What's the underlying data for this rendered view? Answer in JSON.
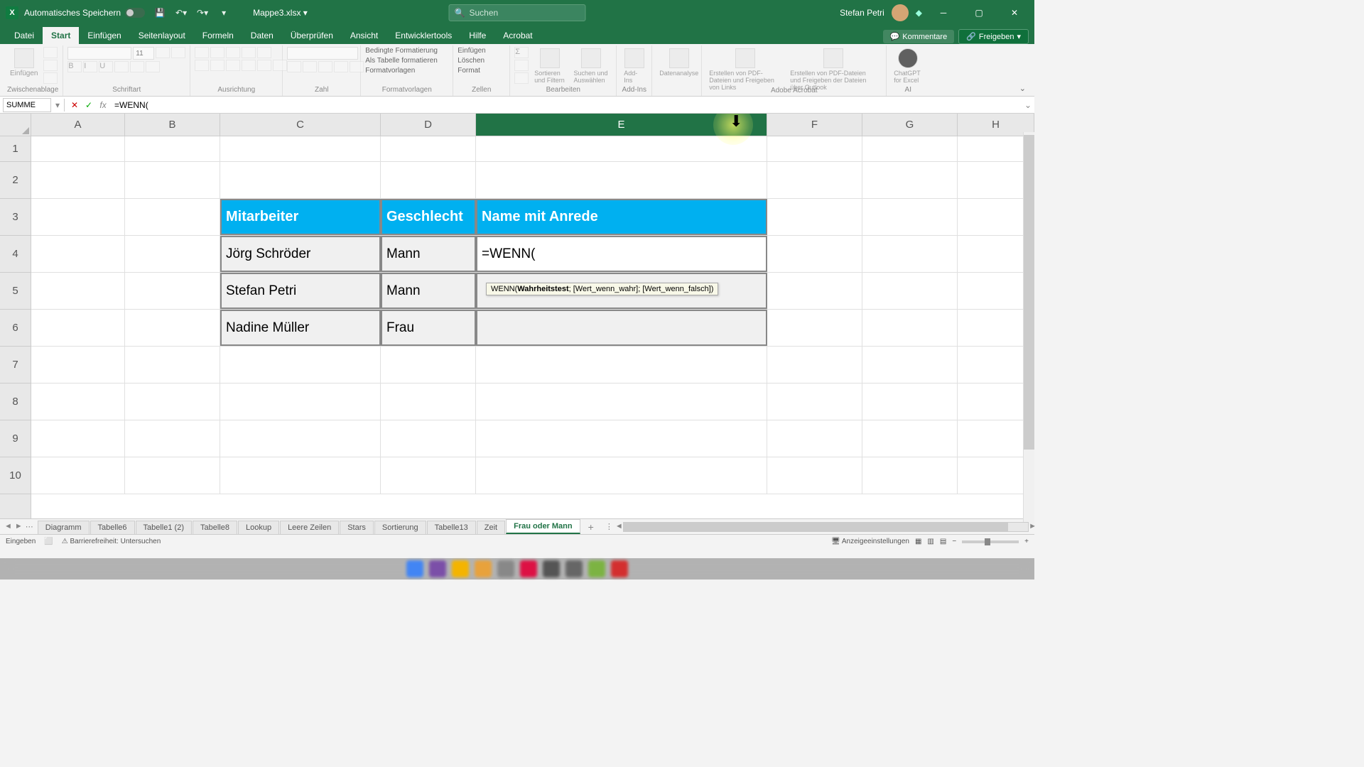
{
  "titlebar": {
    "autosave_label": "Automatisches Speichern",
    "filename": "Mappe3.xlsx",
    "search_placeholder": "Suchen",
    "username": "Stefan Petri"
  },
  "ribbon_tabs": {
    "file": "Datei",
    "home": "Start",
    "insert": "Einfügen",
    "pagelayout": "Seitenlayout",
    "formulas": "Formeln",
    "data": "Daten",
    "review": "Überprüfen",
    "view": "Ansicht",
    "developer": "Entwicklertools",
    "help": "Hilfe",
    "acrobat": "Acrobat",
    "comments": "Kommentare",
    "share": "Freigeben"
  },
  "ribbon": {
    "paste": "Einfügen",
    "clipboard": "Zwischenablage",
    "font_group": "Schriftart",
    "alignment": "Ausrichtung",
    "number": "Zahl",
    "cond_format": "Bedingte Formatierung",
    "as_table": "Als Tabelle formatieren",
    "cell_styles": "Formatvorlagen",
    "styles_group": "Formatvorlagen",
    "insert_cells": "Einfügen",
    "delete_cells": "Löschen",
    "format_cells": "Format",
    "cells_group": "Zellen",
    "sort_filter": "Sortieren und Filtern",
    "find_select": "Suchen und Auswählen",
    "editing": "Bearbeiten",
    "addins": "Add-Ins",
    "addins_group": "Add-Ins",
    "data_analysis": "Datenanalyse",
    "pdf1": "Erstellen von PDF-Dateien und Freigeben von Links",
    "pdf2": "Erstellen von PDF-Dateien und Freigeben der Dateien über Outlook",
    "acrobat_group": "Adobe Acrobat",
    "chatgpt": "ChatGPT for Excel",
    "ai_group": "AI"
  },
  "formula_bar": {
    "namebox": "SUMME",
    "formula": "=WENN("
  },
  "columns": [
    "A",
    "B",
    "C",
    "D",
    "E",
    "F",
    "G",
    "H"
  ],
  "rows": [
    "1",
    "2",
    "3",
    "4",
    "5",
    "6",
    "7",
    "8",
    "9",
    "10"
  ],
  "table": {
    "h1": "Mitarbeiter",
    "h2": "Geschlecht",
    "h3": "Name mit Anrede",
    "r1c1": "Jörg Schröder",
    "r1c2": "Mann",
    "r1c3": "=WENN(",
    "r2c1": "Stefan Petri",
    "r2c2": "Mann",
    "r3c1": "Nadine Müller",
    "r3c2": "Frau"
  },
  "tooltip": {
    "func": "WENN(",
    "bold": "Wahrheitstest",
    "rest": "; [Wert_wenn_wahr]; [Wert_wenn_falsch])"
  },
  "sheets": {
    "s1": "Diagramm",
    "s2": "Tabelle6",
    "s3": "Tabelle1 (2)",
    "s4": "Tabelle8",
    "s5": "Lookup",
    "s6": "Leere Zeilen",
    "s7": "Stars",
    "s8": "Sortierung",
    "s9": "Tabelle13",
    "s10": "Zeit",
    "s11": "Frau oder Mann"
  },
  "status": {
    "mode": "Eingeben",
    "accessibility": "Barrierefreiheit: Untersuchen",
    "display": "Anzeigeeinstellungen"
  }
}
